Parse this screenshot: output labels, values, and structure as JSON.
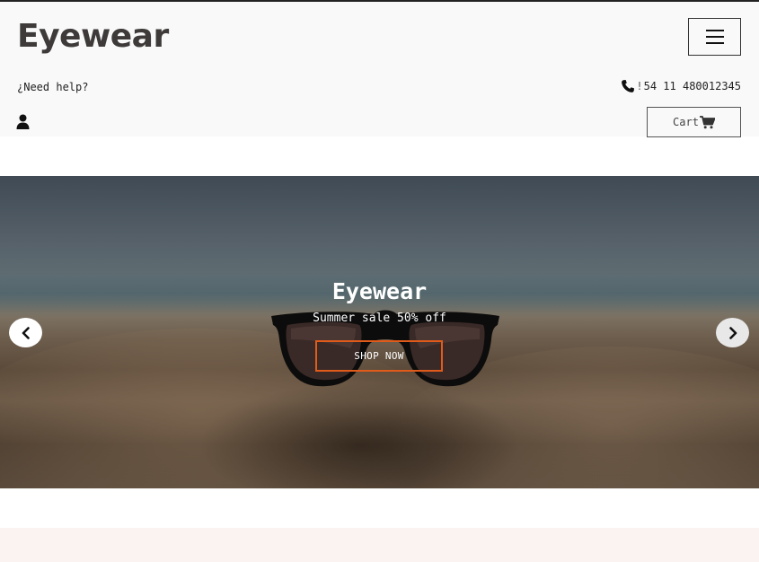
{
  "header": {
    "brand": "Eyewear",
    "help_text": "¿Need help?",
    "phone_number": "54 11 480012345",
    "cart_label": "Cart"
  },
  "hero": {
    "title": "Eyewear",
    "subtitle": "Summer sale 50% off",
    "cta_label": "SHOP NOW"
  },
  "icons": {
    "menu": "hamburger-icon",
    "phone": "phone-icon",
    "user": "user-icon",
    "cart": "cart-icon",
    "prev": "chevron-left-icon",
    "next": "chevron-right-icon"
  },
  "colors": {
    "header_bg": "#f9f9f9",
    "brand_text": "#3e3a3a",
    "cta_border": "#e05a1a",
    "bottom_band": "#fbf2f2"
  }
}
